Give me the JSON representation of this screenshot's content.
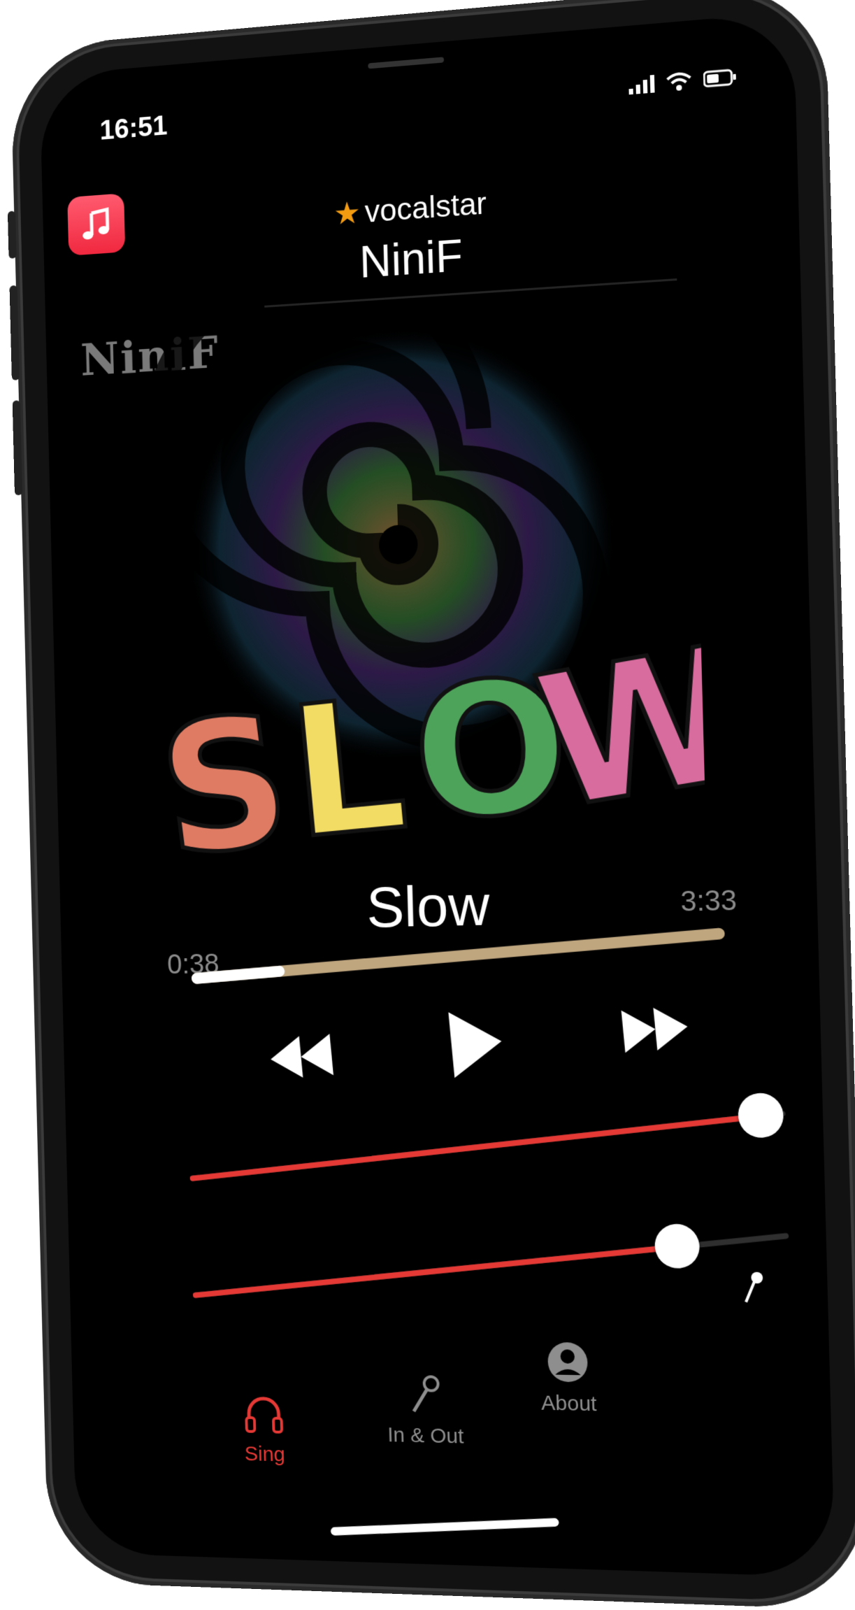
{
  "status": {
    "time": "16:51",
    "signal_icon": "signal-icon",
    "wifi_icon": "wifi-icon",
    "battery_icon": "battery-icon"
  },
  "app_icon": "music-note-icon",
  "header": {
    "brand": "vocalstar",
    "artist": "NiniF"
  },
  "artwork": {
    "brand_text": "NiniF",
    "title_art": "SLOW",
    "letter_colors": [
      "#e07b63",
      "#f3dc63",
      "#4ea35b",
      "#d96c9e"
    ]
  },
  "track": {
    "title": "Slow",
    "elapsed": "0:38",
    "total": "3:33",
    "progress": 0.18
  },
  "controls": {
    "rewind_icon": "rewind-icon",
    "play_icon": "play-icon",
    "forward_icon": "fast-forward-icon"
  },
  "sliders": {
    "music_level": 0.96,
    "vocal_level": 0.82
  },
  "tabs": [
    {
      "label": "Sing",
      "icon": "headphones-icon",
      "active": true
    },
    {
      "label": "In & Out",
      "icon": "microphone-icon",
      "active": false
    },
    {
      "label": "About",
      "icon": "person-circle-icon",
      "active": false
    }
  ],
  "colors": {
    "accent": "#e53935",
    "progress_track": "#bfa67f"
  }
}
